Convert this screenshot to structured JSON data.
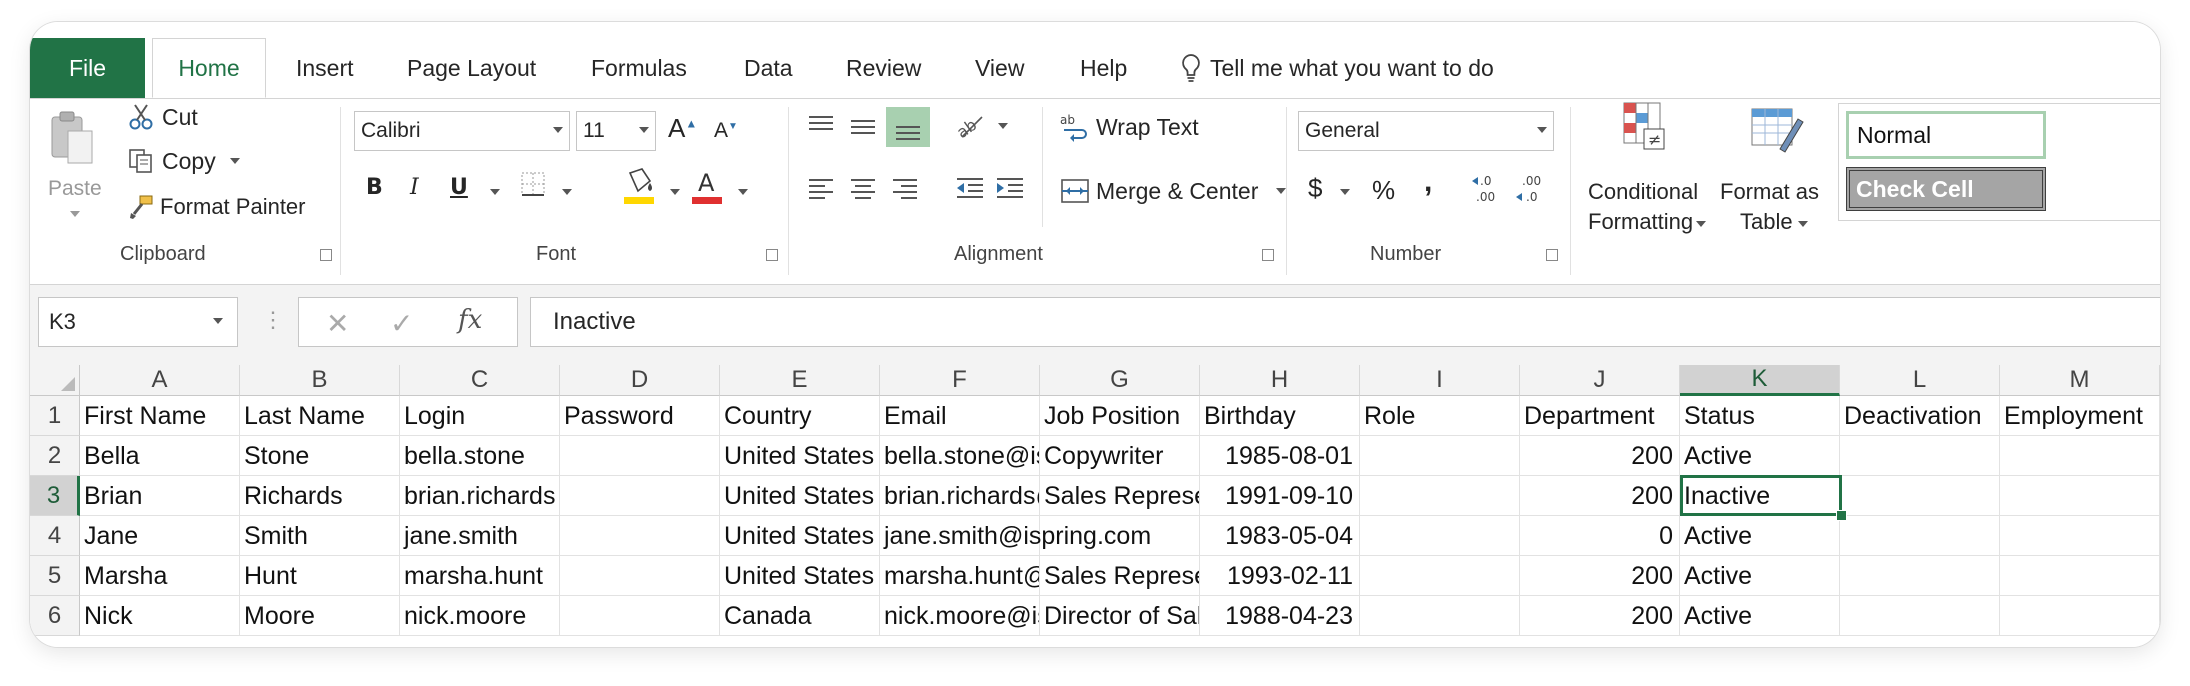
{
  "tabs": {
    "file": "File",
    "home": "Home",
    "insert": "Insert",
    "page_layout": "Page Layout",
    "formulas": "Formulas",
    "data": "Data",
    "review": "Review",
    "view": "View",
    "help": "Help",
    "tell_me": "Tell me what you want to do"
  },
  "clipboard": {
    "paste": "Paste",
    "cut": "Cut",
    "copy": "Copy",
    "format_painter": "Format Painter",
    "label": "Clipboard"
  },
  "font": {
    "name": "Calibri",
    "size": "11",
    "bold": "B",
    "italic": "I",
    "underline": "U",
    "label": "Font"
  },
  "alignment": {
    "wrap_text": "Wrap Text",
    "merge_center": "Merge & Center",
    "label": "Alignment"
  },
  "number": {
    "format": "General",
    "currency": "$",
    "percent": "%",
    "comma": ",",
    "label": "Number"
  },
  "styles": {
    "conditional_1": "Conditional",
    "conditional_2": "Formatting",
    "format_table_1": "Format as",
    "format_table_2": "Table",
    "normal": "Normal",
    "check_cell": "Check Cell"
  },
  "formula_bar": {
    "name_box": "K3",
    "fx": "fx",
    "content": "Inactive"
  },
  "columns": [
    "A",
    "B",
    "C",
    "D",
    "E",
    "F",
    "G",
    "H",
    "I",
    "J",
    "K",
    "L",
    "M"
  ],
  "rows": [
    {
      "num": "1",
      "cells": [
        "First Name",
        "Last Name",
        "Login",
        "Password",
        "Country",
        "Email",
        "Job Position",
        "Birthday",
        "Role",
        "Department",
        "Status",
        "Deactivation",
        "Employment"
      ]
    },
    {
      "num": "2",
      "cells": [
        "Bella",
        "Stone",
        "bella.stone",
        "",
        "United States",
        "bella.stone@ispring.com",
        "Copywriter",
        "1985-08-01",
        "",
        "200",
        "Active",
        "",
        ""
      ]
    },
    {
      "num": "3",
      "cells": [
        "Brian",
        "Richards",
        "brian.richards",
        "",
        "United States",
        "brian.richards@ispring.com",
        "Sales Representative",
        "1991-09-10",
        "",
        "200",
        "Inactive",
        "",
        ""
      ]
    },
    {
      "num": "4",
      "cells": [
        "Jane",
        "Smith",
        "jane.smith",
        "",
        "United States",
        "jane.smith@ispring.com",
        "",
        "1983-05-04",
        "",
        "0",
        "Active",
        "",
        ""
      ]
    },
    {
      "num": "5",
      "cells": [
        "Marsha",
        "Hunt",
        "marsha.hunt",
        "",
        "United States",
        "marsha.hunt@ispring.com",
        "Sales Representative",
        "1993-02-11",
        "",
        "200",
        "Active",
        "",
        ""
      ]
    },
    {
      "num": "6",
      "cells": [
        "Nick",
        "Moore",
        "nick.moore",
        "",
        "Canada",
        "nick.moore@ispring.com",
        "Director of Sales",
        "1988-04-23",
        "",
        "200",
        "Active",
        "",
        ""
      ]
    }
  ],
  "colors": {
    "accent": "#217346",
    "selected_cell_border": "#217346",
    "check_cell_fill": "#a5a5a5"
  }
}
